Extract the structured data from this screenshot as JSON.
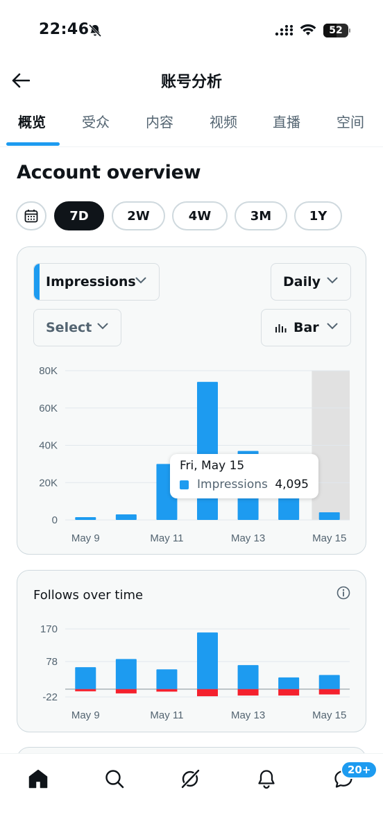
{
  "status_bar": {
    "time": "22:46",
    "battery": "52"
  },
  "header": {
    "title": "账号分析"
  },
  "tabs": [
    {
      "label": "概览"
    },
    {
      "label": "受众"
    },
    {
      "label": "内容"
    },
    {
      "label": "视频"
    },
    {
      "label": "直播"
    },
    {
      "label": "空间"
    }
  ],
  "overview": {
    "title": "Account overview",
    "ranges": [
      "7D",
      "2W",
      "4W",
      "3M",
      "1Y"
    ],
    "selected_range": "7D"
  },
  "controls": {
    "metric": "Impressions",
    "period": "Daily",
    "select_placeholder": "Select",
    "chart_type": "Bar"
  },
  "tooltip": {
    "date": "Fri, May 15",
    "label": "Impressions",
    "value": "4,095"
  },
  "follows": {
    "title": "Follows over time"
  },
  "bottom_nav": {
    "badge": "20+"
  },
  "colors": {
    "accent": "#1d9bf0",
    "negative": "#f4212e",
    "highlight_column": "#e1e1e1"
  },
  "chart_data": [
    {
      "type": "bar",
      "xlabel": "",
      "ylabel": "",
      "categories": [
        "May 9",
        "May 10",
        "May 11",
        "May 12",
        "May 13",
        "May 14",
        "May 15"
      ],
      "tick_labels": [
        "May 9",
        "May 11",
        "May 13",
        "May 15"
      ],
      "series": [
        {
          "name": "Impressions",
          "values": [
            1500,
            3000,
            30000,
            74000,
            37000,
            25000,
            4095
          ]
        }
      ],
      "ylim": [
        0,
        80000
      ],
      "yticks": [
        "80K",
        "60K",
        "40K",
        "20K",
        "0"
      ],
      "highlighted_category": "May 15",
      "grid": true
    },
    {
      "type": "bar",
      "title": "Follows over time",
      "xlabel": "",
      "ylabel": "",
      "categories": [
        "May 9",
        "May 10",
        "May 11",
        "May 12",
        "May 13",
        "May 14",
        "May 15"
      ],
      "tick_labels": [
        "May 9",
        "May 11",
        "May 13",
        "May 15"
      ],
      "series": [
        {
          "values": [
            62,
            85,
            56,
            160,
            68,
            33,
            40
          ]
        },
        {
          "values": [
            -6,
            -12,
            -7,
            -20,
            -18,
            -18,
            -15
          ]
        }
      ],
      "ylim": [
        -22,
        170
      ],
      "yticks": [
        "170",
        "78",
        "-22"
      ],
      "grid": true
    }
  ]
}
